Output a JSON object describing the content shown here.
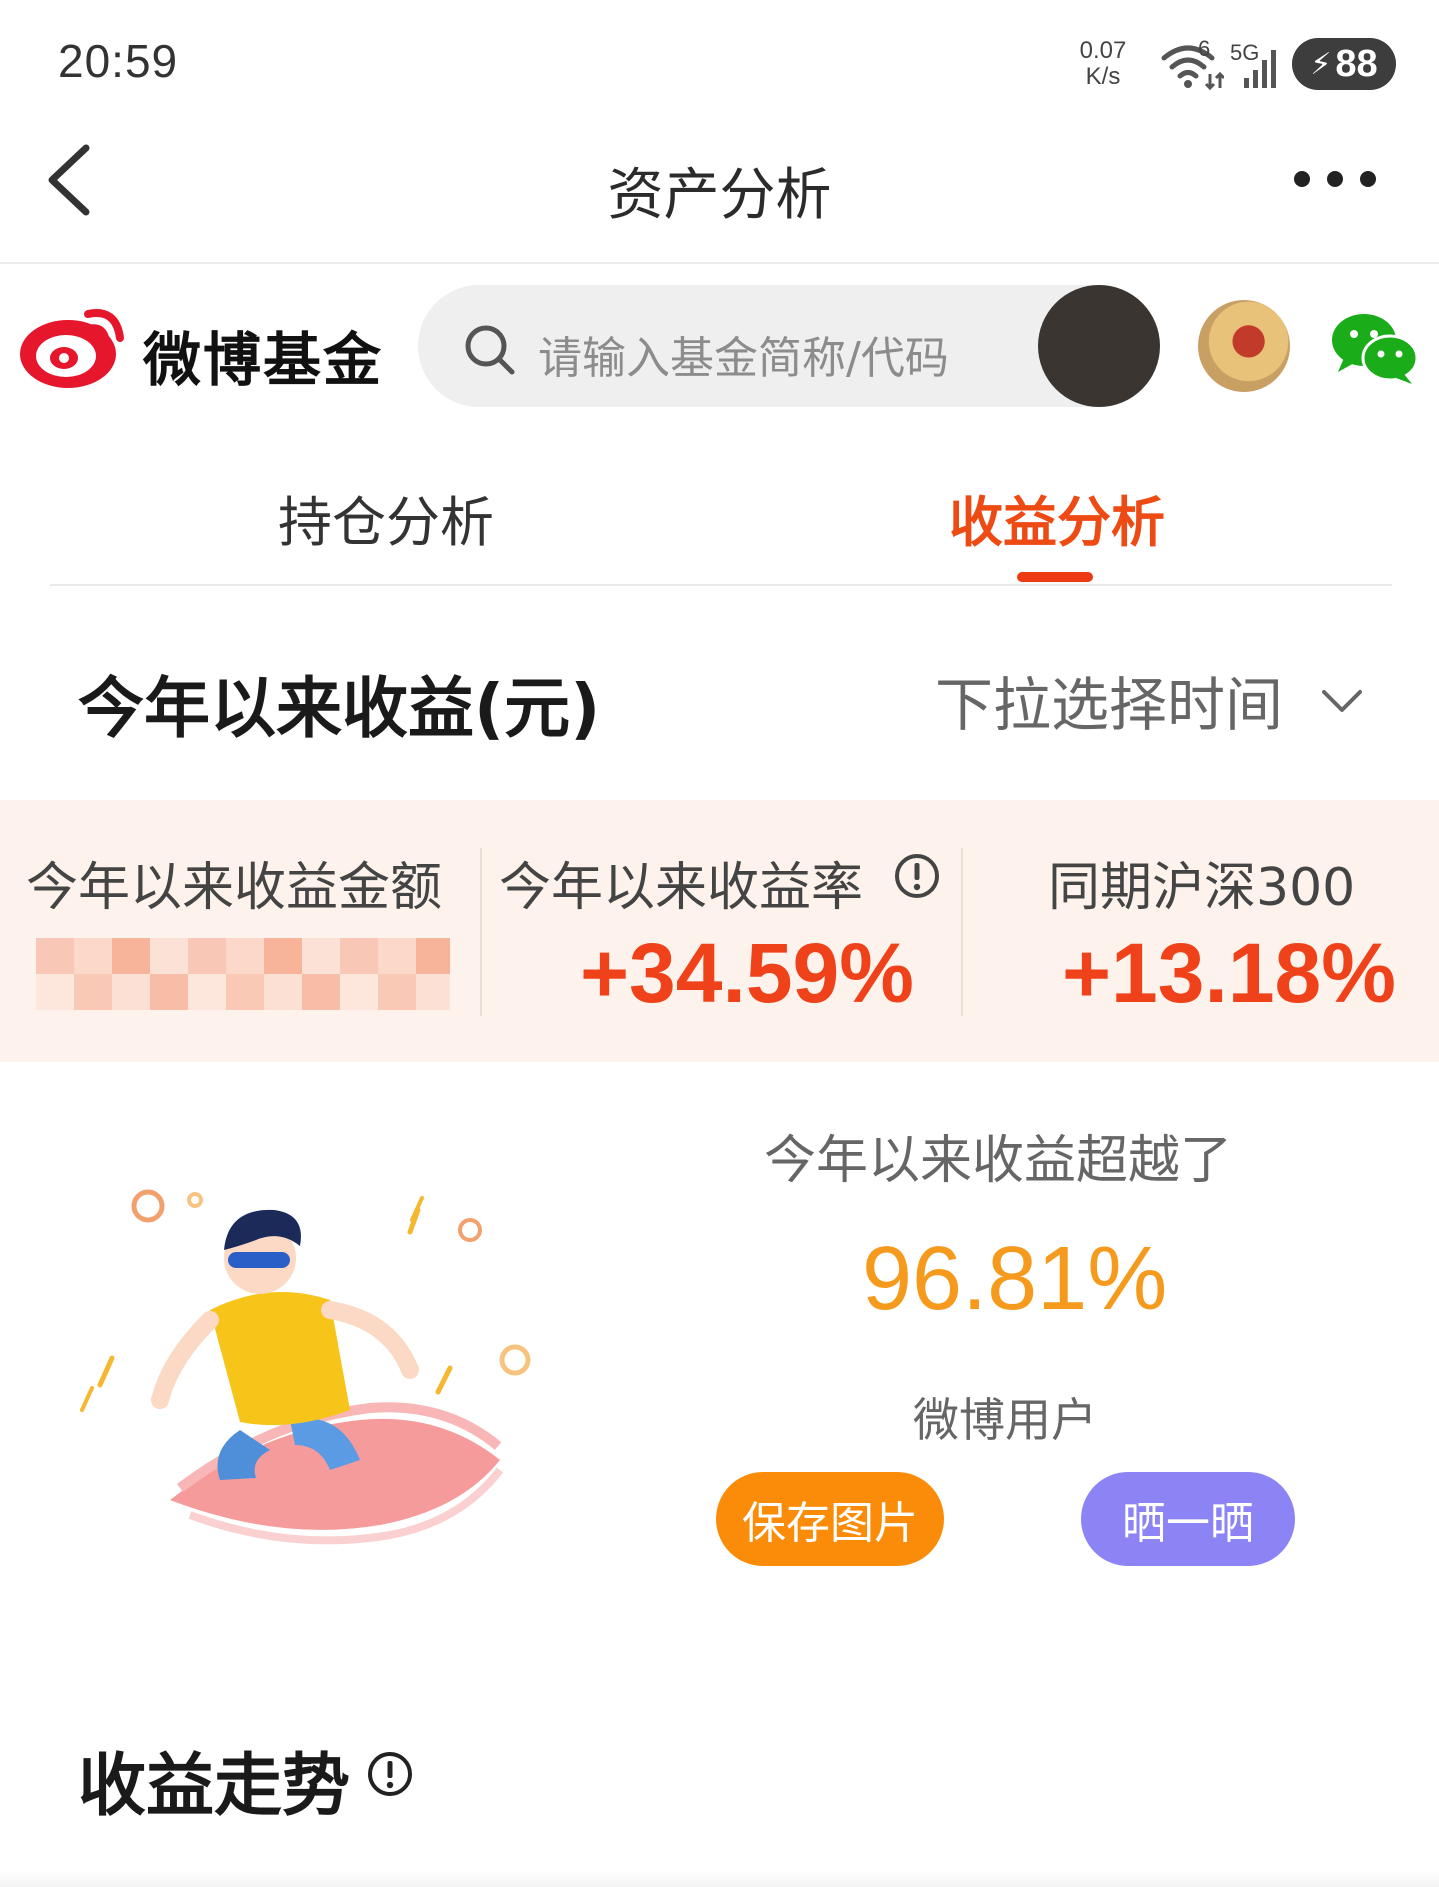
{
  "status_bar": {
    "time": "20:59",
    "net_speed_value": "0.07",
    "net_speed_unit": "K/s",
    "wifi_label": "6",
    "cell_label": "5G",
    "battery": "88"
  },
  "header": {
    "title": "资产分析"
  },
  "brand": {
    "name": "微博基金"
  },
  "search": {
    "placeholder": "请输入基金简称/代码"
  },
  "tabs": [
    {
      "label": "持仓分析",
      "active": false
    },
    {
      "label": "收益分析",
      "active": true
    }
  ],
  "section": {
    "title": "今年以来收益(元)",
    "time_select": "下拉选择时间"
  },
  "summary": {
    "amount_label": "今年以来收益金额",
    "rate_label": "今年以来收益率",
    "rate_value": "+34.59%",
    "benchmark_label": "同期沪深300",
    "benchmark_value": "+13.18%"
  },
  "beat": {
    "caption": "今年以来收益超越了",
    "percent": "96.81%",
    "subject": "微博用户",
    "save_label": "保存图片",
    "share_label": "晒一晒"
  },
  "trend": {
    "title": "收益走势"
  },
  "colors": {
    "accent_red": "#f0421a",
    "orange": "#f59a1c",
    "save_button": "#fb8c09",
    "share_button": "#8c83f5",
    "summary_bg": "#fdf3ec"
  },
  "icons": [
    "back-icon",
    "more-icon",
    "weibo-logo-icon",
    "search-icon",
    "wechat-icon",
    "info-icon",
    "chevron-down-icon",
    "wifi-icon",
    "signal-icon",
    "bolt-icon"
  ]
}
